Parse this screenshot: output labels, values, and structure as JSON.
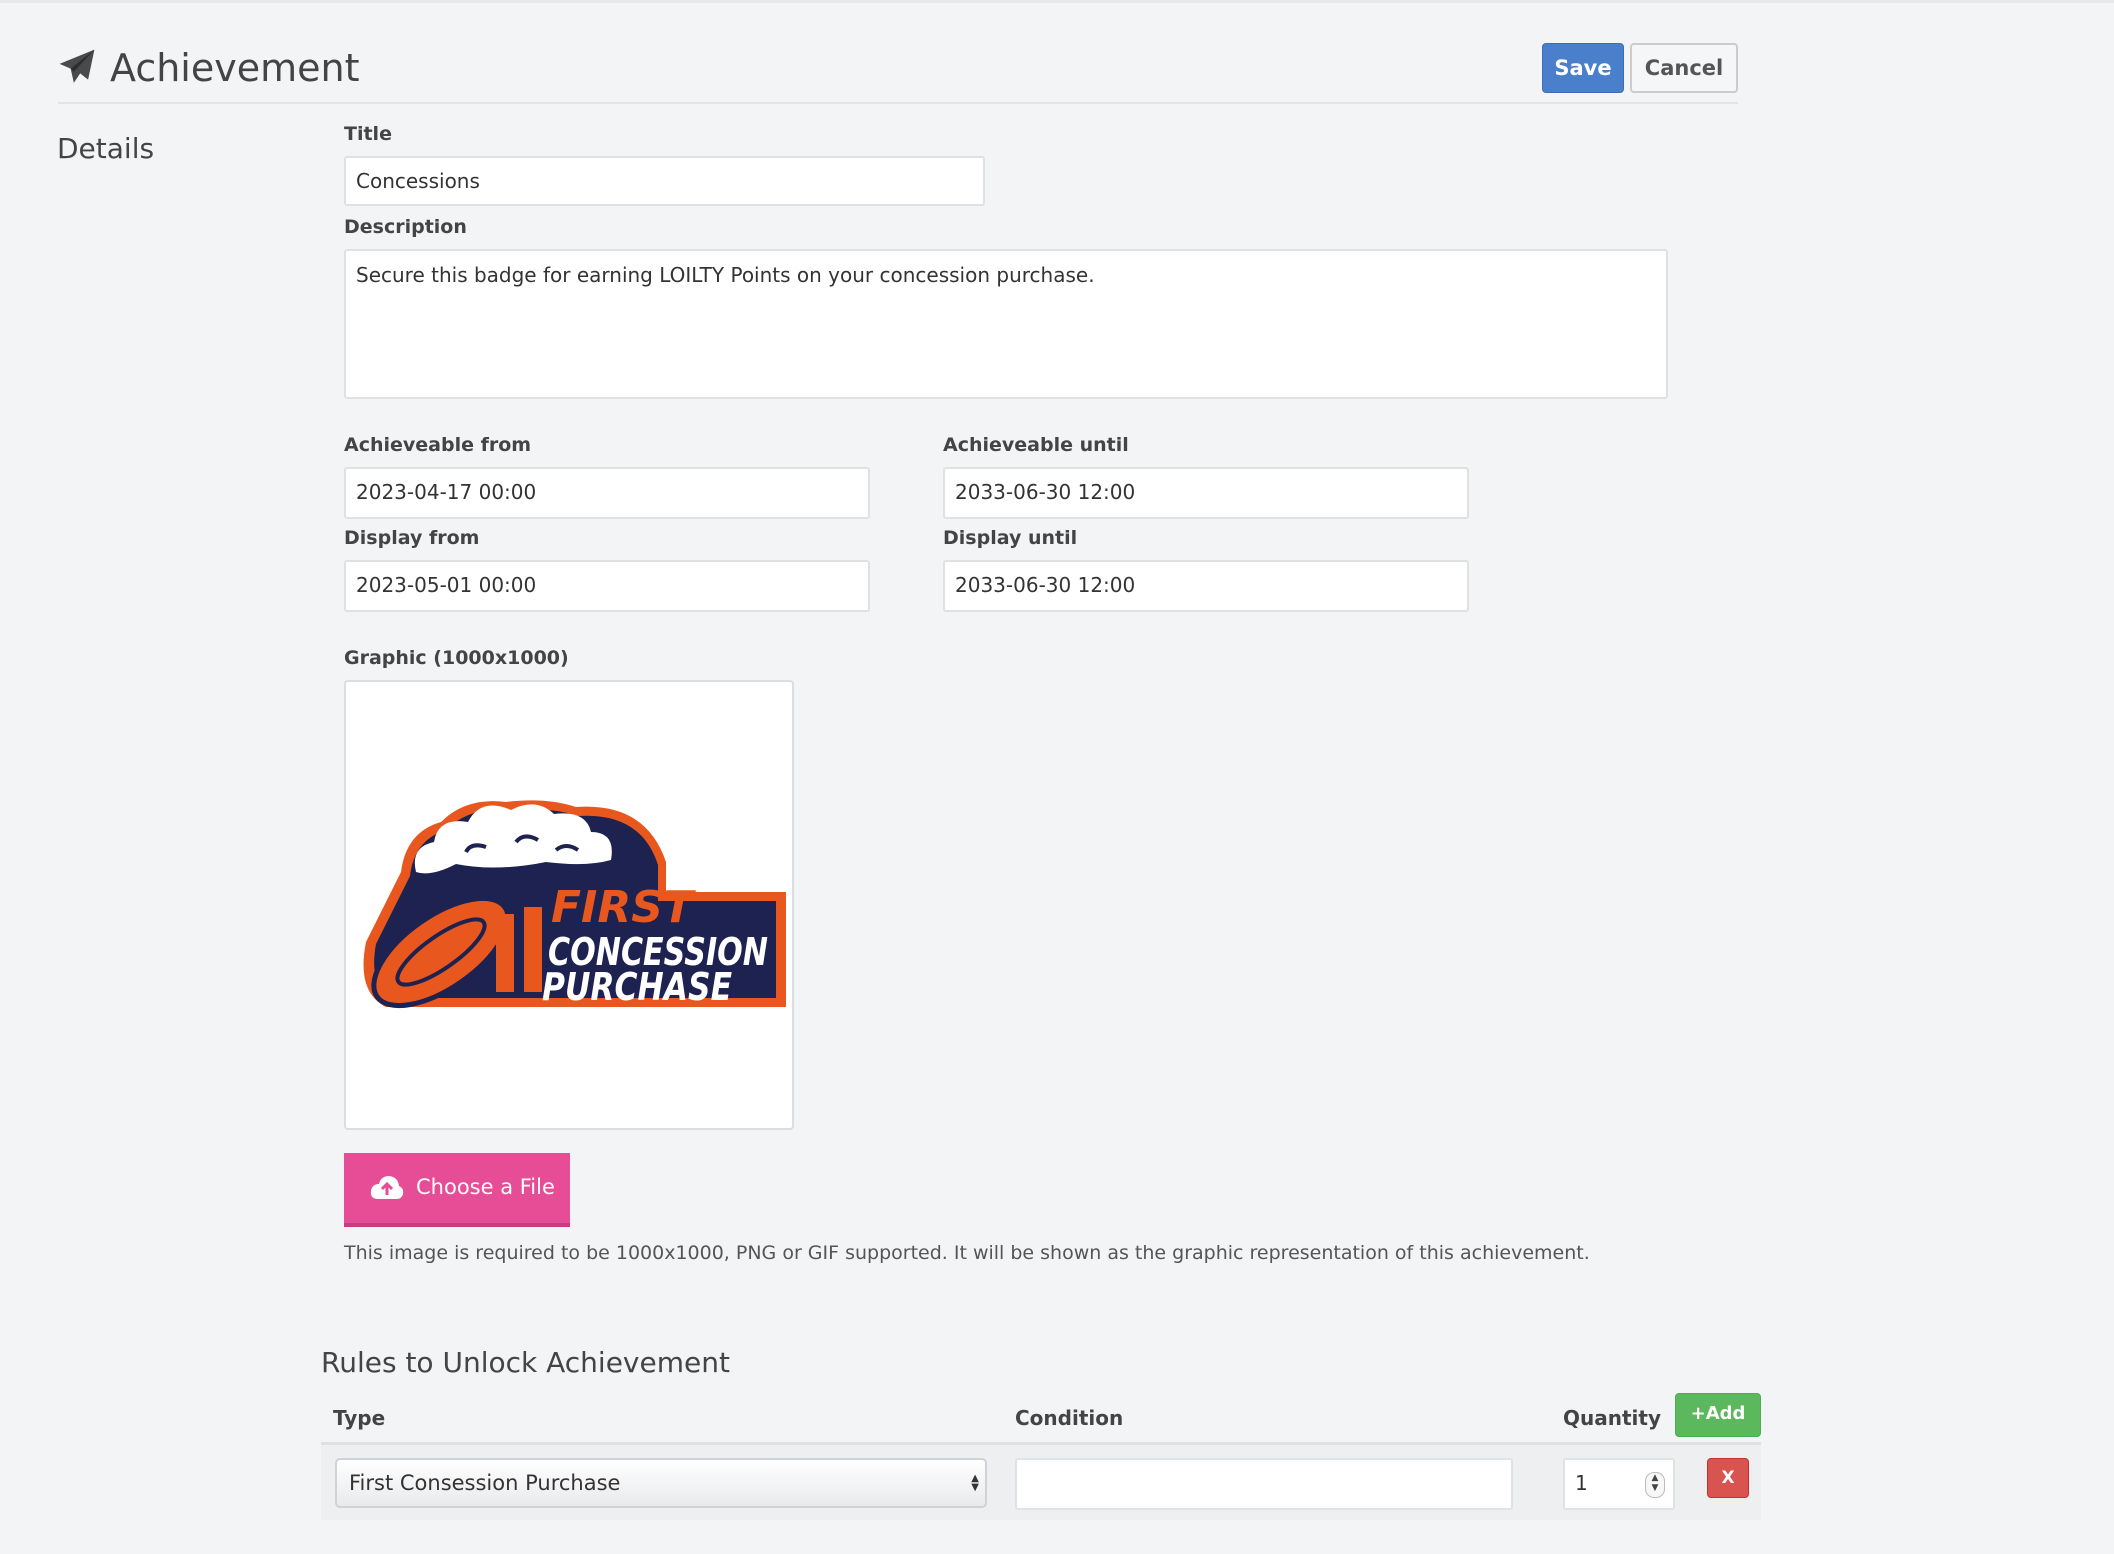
{
  "header": {
    "icon": "paper-plane-icon",
    "title": "Achievement",
    "save_label": "Save",
    "cancel_label": "Cancel"
  },
  "details": {
    "section_label": "Details",
    "title_label": "Title",
    "title_value": "Concessions",
    "description_label": "Description",
    "description_value": "Secure this badge for earning LOILTY Points on your concession purchase.",
    "achievable_from_label": "Achieveable from",
    "achievable_from_value": "2023-04-17 00:00",
    "achievable_until_label": "Achieveable until",
    "achievable_until_value": "2033-06-30 12:00",
    "display_from_label": "Display from",
    "display_from_value": "2023-05-01 00:00",
    "display_until_label": "Display until",
    "display_until_value": "2033-06-30 12:00"
  },
  "graphic": {
    "label": "Graphic (1000x1000)",
    "badge_lines": [
      "FIRST",
      "CONCESSION",
      "PURCHASE"
    ],
    "choose_file_label": "Choose a File",
    "choose_file_icon": "cloud-upload-icon",
    "hint": "This image is required to be 1000x1000, PNG or GIF supported. It will be shown as the graphic representation of this achievement."
  },
  "rules": {
    "title": "Rules to Unlock Achievement",
    "columns": {
      "type": "Type",
      "condition": "Condition",
      "quantity": "Quantity"
    },
    "add_label": "Add",
    "rows": [
      {
        "type": "First Consession Purchase",
        "condition": "",
        "quantity": "1",
        "remove_label": "X"
      }
    ]
  },
  "colors": {
    "primary": "#4a7fcb",
    "choose_file": "#e74c97",
    "add": "#5cb85c",
    "remove": "#d9534f",
    "badge_navy": "#1d2250",
    "badge_orange": "#e8581e"
  }
}
